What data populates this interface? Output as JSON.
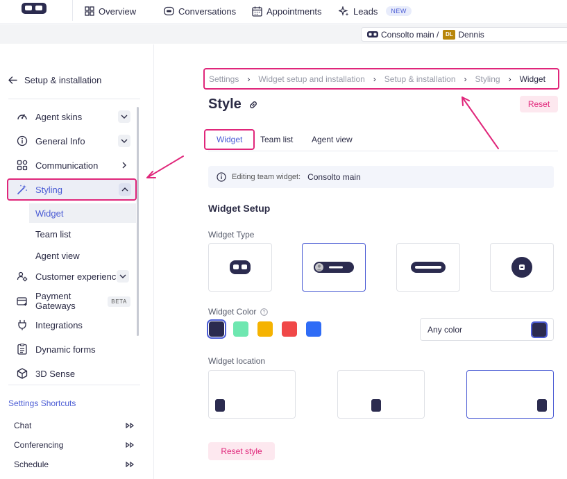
{
  "topnav": {
    "items": [
      {
        "label": "Overview",
        "icon": "grid-icon"
      },
      {
        "label": "Conversations",
        "icon": "chat-icon"
      },
      {
        "label": "Appointments",
        "icon": "calendar-icon"
      },
      {
        "label": "Leads",
        "icon": "sparkle-icon",
        "badge": "NEW"
      }
    ]
  },
  "subbar": {
    "account": "Consolto main /",
    "user_initials": "DL",
    "user_name": "Dennis"
  },
  "sidebar": {
    "back_label": "Setup & installation",
    "items": [
      {
        "label": "Agent skins",
        "icon": "agent-skin-icon"
      },
      {
        "label": "General Info",
        "icon": "info-icon"
      },
      {
        "label": "Communication",
        "icon": "apps-icon"
      },
      {
        "label": "Styling",
        "icon": "magic-wand-icon"
      },
      {
        "label": "Customer experience",
        "icon": "settings-user-icon"
      },
      {
        "label": "Payment Gateways",
        "icon": "credit-card-icon",
        "badge": "BETA"
      },
      {
        "label": "Integrations",
        "icon": "plug-icon"
      },
      {
        "label": "Dynamic forms",
        "icon": "form-icon"
      },
      {
        "label": "3D Sense",
        "icon": "cube-icon"
      }
    ],
    "styling_sub": [
      "Widget",
      "Team list",
      "Agent view"
    ],
    "payment_line1": "Payment",
    "payment_line2": "Gateways",
    "shortcuts_title": "Settings Shortcuts",
    "shortcuts": [
      "Chat",
      "Conferencing",
      "Schedule"
    ]
  },
  "main": {
    "breadcrumb": [
      "Settings",
      "Widget setup and installation",
      "Setup & installation",
      "Styling",
      "Widget"
    ],
    "title": "Style",
    "reset_label": "Reset",
    "tabs": [
      "Widget",
      "Team list",
      "Agent view"
    ],
    "info_label": "Editing team widget:",
    "info_value": "Consolto main",
    "section_title": "Widget Setup",
    "widget_type_label": "Widget Type",
    "widget_color_label": "Widget Color",
    "colors": [
      "#2b2b4f",
      "#6ee7b0",
      "#f5b301",
      "#f04848",
      "#2f6cf6"
    ],
    "any_color_label": "Any color",
    "widget_location_label": "Widget location",
    "reset_style_label": "Reset style"
  },
  "accent": "#4a5bd4",
  "highlight": "#e0267a"
}
